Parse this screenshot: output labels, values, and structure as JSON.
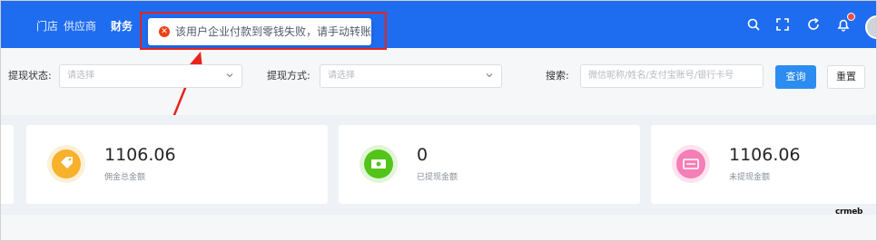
{
  "topnav": {
    "items": [
      "门店",
      "供应商",
      "财务"
    ],
    "active_index": 2,
    "icons": [
      "search-icon",
      "fullscreen-icon",
      "refresh-icon",
      "bell-icon"
    ]
  },
  "toast": {
    "message": "该用户企业付款到零钱失败，请手动转账",
    "type": "error",
    "icon": "error-circle-icon"
  },
  "filters": {
    "status_label": "提现状态:",
    "status_placeholder": "请选择",
    "method_label": "提现方式:",
    "method_placeholder": "请选择",
    "search_label": "搜索:",
    "search_placeholder": "微信昵称/姓名/支付宝账号/银行卡号",
    "query_button": "查询",
    "reset_button": "重置"
  },
  "stats": [
    {
      "value": "1106.06",
      "label": "佣金总金额",
      "color": "#f7b12b",
      "icon": "tag-icon"
    },
    {
      "value": "0",
      "label": "已提现金额",
      "color": "#52c41a",
      "icon": "money-icon"
    },
    {
      "value": "1106.06",
      "label": "未提现金额",
      "color": "#f47eb5",
      "icon": "wallet-icon"
    }
  ],
  "watermark": "crmeb",
  "colors": {
    "topbar": "#1e6cf0",
    "primary": "#2d8cf0",
    "annotation": "#e8231b"
  }
}
